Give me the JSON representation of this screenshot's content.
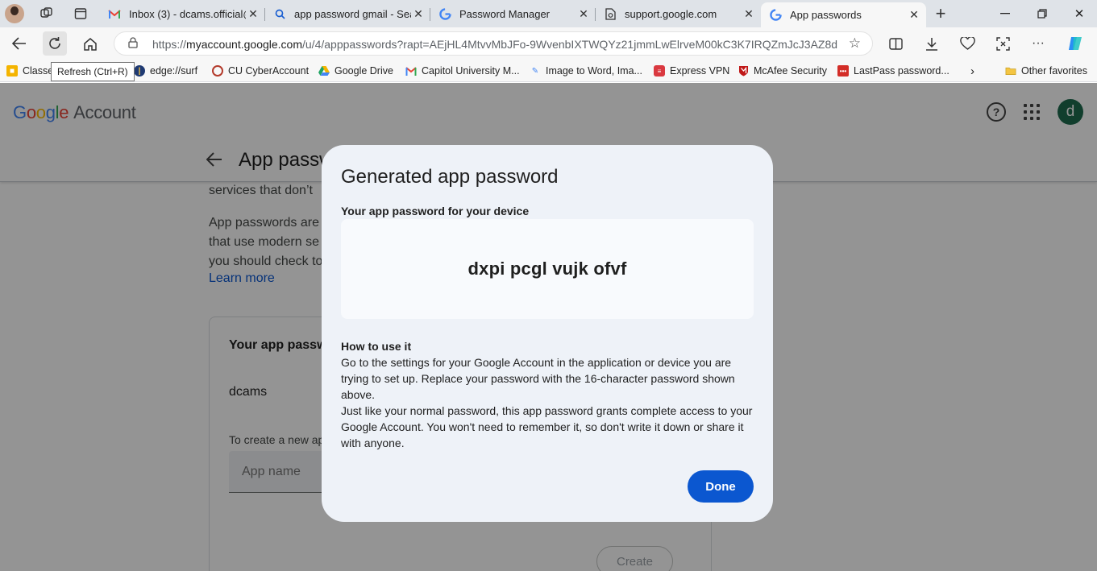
{
  "tabs": [
    {
      "title": "Inbox (3) - dcams.official@g",
      "icon": "gmail-icon"
    },
    {
      "title": "app password gmail - Searc",
      "icon": "search-icon"
    },
    {
      "title": "Password Manager",
      "icon": "google-icon"
    },
    {
      "title": "support.google.com",
      "icon": "page-icon"
    },
    {
      "title": "App passwords",
      "icon": "google-icon",
      "active": true
    }
  ],
  "address": {
    "url_prefix": "https://",
    "url_host": "myaccount.google.com",
    "url_path": "/u/4/apppasswords?rapt=AEjHL4MtvvMbJFo-9WvenbIXTWQYz21jmmLwElrveM00kC3K7IRQZmJcJ3AZ8d..."
  },
  "bookmarks": [
    {
      "label": "Classe",
      "color": "#f4b400"
    },
    {
      "label": "edge://surf",
      "color": "#1f3a73"
    },
    {
      "label": "CU CyberAccount",
      "color": "#b33a2b"
    },
    {
      "label": "Google Drive",
      "color": "#1fa463"
    },
    {
      "label": "Capitol University M...",
      "color": "#ea4335"
    },
    {
      "label": "Image to Word, Ima...",
      "color": "#4285f4"
    },
    {
      "label": "Express VPN",
      "color": "#da3940"
    },
    {
      "label": "McAfee Security",
      "color": "#c01818"
    },
    {
      "label": "LastPass password...",
      "color": "#d32d27"
    },
    {
      "label": "Other favorites",
      "color": "#f4c542"
    }
  ],
  "tooltip": "Refresh (Ctrl+R)",
  "header": {
    "logo_google": "Google",
    "logo_account": "Account",
    "avatar_letter": "d"
  },
  "page": {
    "title": "App passwords",
    "line1": "services that don’t",
    "line2": "App passwords are",
    "line3": "that use modern se",
    "line4": "you should check to",
    "learn_more": "Learn more",
    "card_title": "Your app passwords",
    "entry_name": "dcams",
    "create_hint": "To create a new app",
    "app_name_placeholder": "App name",
    "create_button": "Create"
  },
  "dialog": {
    "title": "Generated app password",
    "subtitle": "Your app password for your device",
    "password": "dxpi pcgl vujk ofvf",
    "howto_heading": "How to use it",
    "para1": "Go to the settings for your Google Account in the application or device you are trying to set up. Replace your password with the 16-character password shown above.",
    "para2": "Just like your normal password, this app password grants complete access to your Google Account. You won't need to remember it, so don't write it down or share it with anyone.",
    "done_button": "Done"
  }
}
